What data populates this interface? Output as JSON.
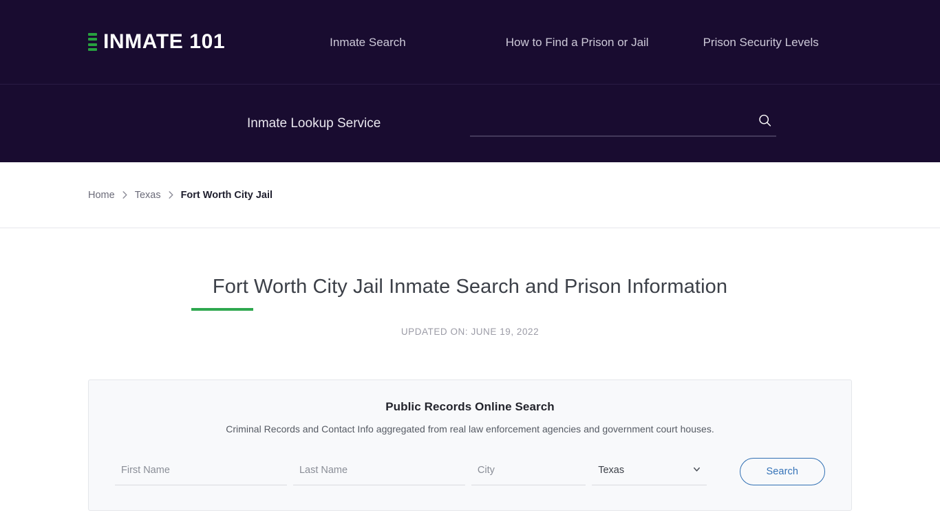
{
  "header": {
    "logo_text": "INMATE 101",
    "logo_mark_bars": 4,
    "logo_accent_color": "#27a03f",
    "background_color": "#190c30",
    "nav": [
      {
        "label": "Inmate Search"
      },
      {
        "label": "How to Find a Prison or Jail"
      },
      {
        "label": "Prison Security Levels"
      }
    ]
  },
  "search_band": {
    "label": "Inmate Lookup Service",
    "input_value": "",
    "input_placeholder": "",
    "icon": "search-icon"
  },
  "breadcrumb": {
    "items": [
      {
        "label": "Home",
        "current": false
      },
      {
        "label": "Texas",
        "current": false
      },
      {
        "label": "Fort Worth City Jail",
        "current": true
      }
    ],
    "separator": "chevron-right-icon"
  },
  "main": {
    "title": "Fort Worth City Jail Inmate Search and Prison Information",
    "title_accent_color": "#2fa84f",
    "updated": "UPDATED ON: JUNE 19, 2022"
  },
  "records_card": {
    "title": "Public Records Online Search",
    "subtitle": "Criminal Records and Contact Info aggregated from real law enforcement agencies and government court houses.",
    "fields": {
      "first_name": {
        "placeholder": "First Name",
        "value": ""
      },
      "last_name": {
        "placeholder": "Last Name",
        "value": ""
      },
      "city": {
        "placeholder": "City",
        "value": ""
      },
      "state": {
        "value": "Texas",
        "options": [
          "Texas"
        ]
      }
    },
    "submit_label": "Search",
    "submit_border_color": "#2f6fb3",
    "background_color": "#f8f9fb"
  }
}
